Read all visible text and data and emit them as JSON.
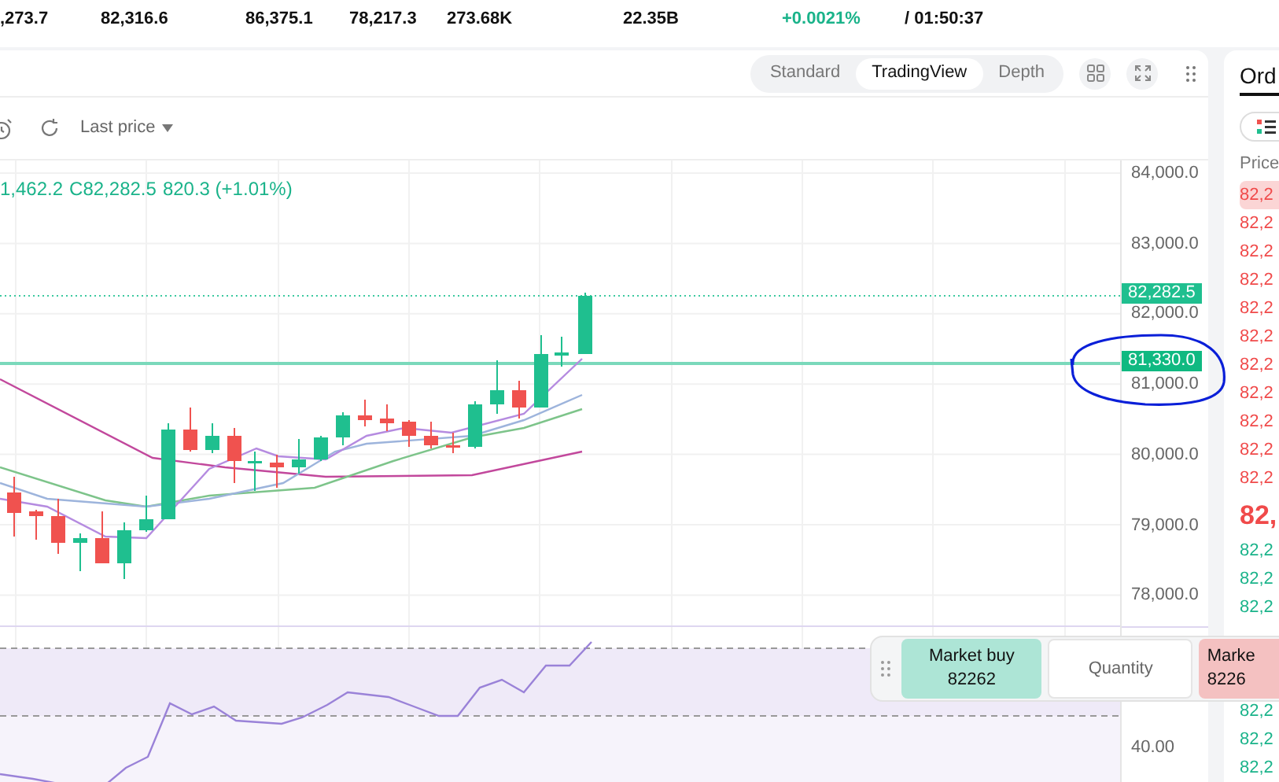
{
  "ticker_stats": [
    {
      "text": ",273.7",
      "kind": "plain"
    },
    {
      "text": "82,316.6",
      "kind": "plain"
    },
    {
      "text": "86,375.1",
      "kind": "plain"
    },
    {
      "text": "78,217.3",
      "kind": "plain"
    },
    {
      "text": "273.68K",
      "kind": "plain"
    },
    {
      "text": "22.35B",
      "kind": "plain"
    },
    {
      "text": "+0.0021%",
      "kind": "change"
    },
    {
      "text": "/ 01:50:37",
      "kind": "plain"
    }
  ],
  "view_modes": [
    {
      "label": "Standard",
      "selected": false
    },
    {
      "label": "TradingView",
      "selected": true
    },
    {
      "label": "Depth",
      "selected": false
    }
  ],
  "toolbar": {
    "price_source": "Last price"
  },
  "legend": [
    "1,462.2",
    "C82,282.5",
    "820.3 (+1.01%)"
  ],
  "price_axis": [
    "84,000.0",
    "83,000.0",
    "82,000.0",
    "81,000.0",
    "80,000.0",
    "79,000.0",
    "78,000.0"
  ],
  "price_tags": [
    {
      "label": "82,282.5",
      "kind": "last"
    },
    {
      "label": "81,330.0",
      "kind": "line"
    }
  ],
  "rsi_axis": [
    "40.00"
  ],
  "order_panel": {
    "tab": "Ord",
    "column": "Price",
    "asks": [
      {
        "price": "82,2",
        "highlighted": true
      },
      {
        "price": "82,2",
        "highlighted": false
      },
      {
        "price": "82,2",
        "highlighted": false
      },
      {
        "price": "82,2",
        "highlighted": false
      },
      {
        "price": "82,2",
        "highlighted": false
      },
      {
        "price": "82,2",
        "highlighted": false
      },
      {
        "price": "82,2",
        "highlighted": false
      },
      {
        "price": "82,2",
        "highlighted": false
      },
      {
        "price": "82,2",
        "highlighted": false
      },
      {
        "price": "82,2",
        "highlighted": false
      },
      {
        "price": "82,2",
        "highlighted": false
      }
    ],
    "mid": "82,",
    "bids_upper": [
      "82,2",
      "82,2",
      "82,2"
    ],
    "bids_lower": [
      "82,2",
      "82,2",
      "82,2"
    ]
  },
  "quick_trade": {
    "buy": {
      "label": "Market buy",
      "price": "82262"
    },
    "quantity_placeholder": "Quantity",
    "sell": {
      "label": "Marke",
      "price": "8226"
    }
  }
}
